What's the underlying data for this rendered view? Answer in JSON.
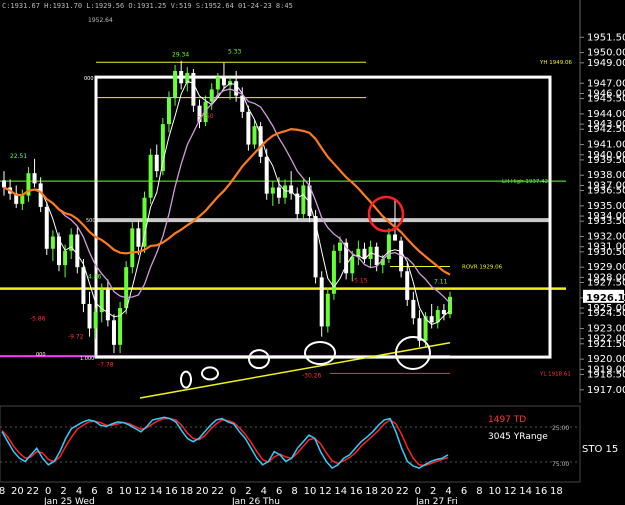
{
  "header": {
    "ohlc_text": "C:1931.67 H:1931.70 L:1929.56 O:1931.25 V:519 S:1952.64 01-24-23 8:45",
    "top_price": "1952.64"
  },
  "colors": {
    "background": "#000000",
    "candle_up": "#66ff33",
    "candle_down": "#ffffff",
    "white_box": "#ffffff",
    "gray_line": "#c8c8c8",
    "orange_ma": "#ff7a1a",
    "pink_ma": "#d49adf",
    "white_ma": "#ffffff",
    "yellow": "#f2f21a",
    "green_level": "#66ff33",
    "magenta_level": "#ff33ff",
    "red_text": "#ff3333",
    "circle_red": "#ff2222",
    "sto_k": "#33ccff",
    "sto_d": "#ff2222"
  },
  "chart_data": {
    "type": "candlestick",
    "ylim": [
      1916,
      1952.8
    ],
    "y_axis_ticks": [
      "1951.50",
      "1950.00",
      "1949.00",
      "1947.00",
      "1946.00",
      "1945.50",
      "1944.00",
      "1943.00",
      "1942.50",
      "1941.00",
      "1940.00",
      "1939.50",
      "1938.00",
      "1937.00",
      "1936.50",
      "1935.00",
      "1934.00",
      "1933.50",
      "1932.00",
      "1931.00",
      "1930.50",
      "1929.00",
      "1928.00",
      "1927.50",
      "1926.00",
      "1925.00",
      "1924.50",
      "1923.00",
      "1922.00",
      "1921.50",
      "1920.00",
      "1919.00",
      "1918.50",
      "1917.00"
    ],
    "last_price": "1926.10",
    "x_hour_labels": [
      "8",
      "20",
      "22",
      "0",
      "2",
      "4",
      "6",
      "8",
      "10",
      "12",
      "14",
      "16",
      "18",
      "20",
      "22",
      "0",
      "2",
      "4",
      "6",
      "8",
      "10",
      "12",
      "14",
      "16",
      "18",
      "20",
      "22",
      "0",
      "2",
      "4",
      "6",
      "8",
      "10",
      "12",
      "14",
      "16",
      "18"
    ],
    "x_day_labels": [
      "Jan 25 Wed",
      "Jan 26 Thu",
      "Jan 27 Fri"
    ],
    "levels": [
      {
        "label": "YH 1949.06",
        "value": 1949.06,
        "color": "yellow"
      },
      {
        "label": "LH High 1937.42",
        "value": 1937.42,
        "color": "green"
      },
      {
        "label": "ROVR 1929.06",
        "value": 1929.06,
        "color": "yellow"
      },
      {
        "label": "",
        "value": 1926.9,
        "color": "yellow"
      },
      {
        "label": "",
        "value": 1933.6,
        "color": "gray"
      },
      {
        "label": "YL 1918.61",
        "value": 1918.61,
        "color": "red"
      },
      {
        "label": "",
        "value": 1920.3,
        "color": "magenta"
      }
    ],
    "annotations": [
      {
        "text": "29.34",
        "price": 1949.6,
        "color": "green"
      },
      {
        "text": "5.33",
        "price": 1949.9,
        "color": "green"
      },
      {
        "text": "22.51",
        "price": 1939.7,
        "color": "green"
      },
      {
        "text": "4.86",
        "price": 1927.9,
        "color": "green"
      },
      {
        "text": "7.11",
        "price": 1927.4,
        "color": "green"
      },
      {
        "text": "-5.86",
        "price": 1923.8,
        "color": "red"
      },
      {
        "text": "-9.72",
        "price": 1922.0,
        "color": "red"
      },
      {
        "text": "-7.78",
        "price": 1919.3,
        "color": "red"
      },
      {
        "text": "-5.15",
        "price": 1927.5,
        "color": "red"
      },
      {
        "text": "-30.26",
        "price": 1918.2,
        "color": "red"
      },
      {
        "text": "-2.50",
        "price": 1943.6,
        "color": "red"
      }
    ],
    "box_labels": [
      "000",
      "500",
      "1.000",
      "000"
    ],
    "candles": [
      {
        "o": 1937.5,
        "h": 1938.4,
        "l": 1936.0,
        "c": 1936.8
      },
      {
        "o": 1936.8,
        "h": 1937.6,
        "l": 1935.6,
        "c": 1936.2
      },
      {
        "o": 1936.2,
        "h": 1937.0,
        "l": 1934.8,
        "c": 1935.2
      },
      {
        "o": 1935.2,
        "h": 1936.6,
        "l": 1934.6,
        "c": 1936.0
      },
      {
        "o": 1936.0,
        "h": 1938.8,
        "l": 1935.4,
        "c": 1938.2
      },
      {
        "o": 1938.2,
        "h": 1939.6,
        "l": 1936.8,
        "c": 1937.2
      },
      {
        "o": 1937.2,
        "h": 1937.8,
        "l": 1934.4,
        "c": 1934.9
      },
      {
        "o": 1934.9,
        "h": 1935.4,
        "l": 1930.2,
        "c": 1930.8
      },
      {
        "o": 1930.8,
        "h": 1932.6,
        "l": 1929.6,
        "c": 1932.0
      },
      {
        "o": 1932.0,
        "h": 1932.4,
        "l": 1928.6,
        "c": 1929.2
      },
      {
        "o": 1929.2,
        "h": 1931.2,
        "l": 1928.0,
        "c": 1930.6
      },
      {
        "o": 1930.6,
        "h": 1932.8,
        "l": 1929.8,
        "c": 1932.2
      },
      {
        "o": 1932.2,
        "h": 1932.9,
        "l": 1928.4,
        "c": 1929.0
      },
      {
        "o": 1929.0,
        "h": 1929.8,
        "l": 1924.6,
        "c": 1925.4
      },
      {
        "o": 1925.4,
        "h": 1926.6,
        "l": 1922.2,
        "c": 1923.0
      },
      {
        "o": 1923.0,
        "h": 1925.0,
        "l": 1922.0,
        "c": 1924.6
      },
      {
        "o": 1924.6,
        "h": 1927.4,
        "l": 1923.6,
        "c": 1926.8
      },
      {
        "o": 1926.8,
        "h": 1927.8,
        "l": 1923.2,
        "c": 1923.8
      },
      {
        "o": 1923.8,
        "h": 1924.4,
        "l": 1920.6,
        "c": 1921.4
      },
      {
        "o": 1921.4,
        "h": 1925.6,
        "l": 1920.6,
        "c": 1925.0
      },
      {
        "o": 1925.0,
        "h": 1929.6,
        "l": 1924.4,
        "c": 1929.0
      },
      {
        "o": 1929.0,
        "h": 1933.4,
        "l": 1928.4,
        "c": 1932.8
      },
      {
        "o": 1932.8,
        "h": 1933.6,
        "l": 1930.2,
        "c": 1931.0
      },
      {
        "o": 1931.0,
        "h": 1936.4,
        "l": 1930.4,
        "c": 1935.8
      },
      {
        "o": 1935.8,
        "h": 1940.6,
        "l": 1935.2,
        "c": 1940.0
      },
      {
        "o": 1940.0,
        "h": 1941.0,
        "l": 1937.8,
        "c": 1938.4
      },
      {
        "o": 1938.4,
        "h": 1943.6,
        "l": 1938.0,
        "c": 1943.0
      },
      {
        "o": 1943.0,
        "h": 1946.2,
        "l": 1942.2,
        "c": 1945.6
      },
      {
        "o": 1945.6,
        "h": 1948.8,
        "l": 1944.8,
        "c": 1948.2
      },
      {
        "o": 1948.2,
        "h": 1949.2,
        "l": 1946.4,
        "c": 1947.0
      },
      {
        "o": 1947.0,
        "h": 1948.6,
        "l": 1946.2,
        "c": 1948.0
      },
      {
        "o": 1948.0,
        "h": 1948.4,
        "l": 1944.2,
        "c": 1944.8
      },
      {
        "o": 1944.8,
        "h": 1945.4,
        "l": 1942.6,
        "c": 1943.2
      },
      {
        "o": 1943.2,
        "h": 1945.8,
        "l": 1942.8,
        "c": 1945.2
      },
      {
        "o": 1945.2,
        "h": 1947.0,
        "l": 1944.4,
        "c": 1946.4
      },
      {
        "o": 1946.4,
        "h": 1948.0,
        "l": 1945.6,
        "c": 1947.6
      },
      {
        "o": 1947.6,
        "h": 1949.0,
        "l": 1946.4,
        "c": 1946.8
      },
      {
        "o": 1946.8,
        "h": 1947.6,
        "l": 1945.4,
        "c": 1947.2
      },
      {
        "o": 1947.2,
        "h": 1948.2,
        "l": 1945.2,
        "c": 1945.8
      },
      {
        "o": 1945.8,
        "h": 1946.6,
        "l": 1943.6,
        "c": 1944.2
      },
      {
        "o": 1944.2,
        "h": 1944.8,
        "l": 1940.4,
        "c": 1941.0
      },
      {
        "o": 1941.0,
        "h": 1943.4,
        "l": 1940.6,
        "c": 1942.8
      },
      {
        "o": 1942.8,
        "h": 1943.2,
        "l": 1939.2,
        "c": 1939.8
      },
      {
        "o": 1939.8,
        "h": 1940.6,
        "l": 1935.6,
        "c": 1936.2
      },
      {
        "o": 1936.2,
        "h": 1937.4,
        "l": 1935.0,
        "c": 1936.8
      },
      {
        "o": 1936.8,
        "h": 1937.8,
        "l": 1935.2,
        "c": 1935.8
      },
      {
        "o": 1935.8,
        "h": 1937.6,
        "l": 1935.2,
        "c": 1937.0
      },
      {
        "o": 1937.0,
        "h": 1938.4,
        "l": 1935.6,
        "c": 1936.2
      },
      {
        "o": 1936.2,
        "h": 1936.8,
        "l": 1933.6,
        "c": 1934.2
      },
      {
        "o": 1934.2,
        "h": 1937.6,
        "l": 1933.8,
        "c": 1937.0
      },
      {
        "o": 1937.0,
        "h": 1937.8,
        "l": 1933.4,
        "c": 1934.0
      },
      {
        "o": 1934.0,
        "h": 1934.6,
        "l": 1927.4,
        "c": 1928.0
      },
      {
        "o": 1928.0,
        "h": 1928.6,
        "l": 1922.2,
        "c": 1923.2
      },
      {
        "o": 1923.2,
        "h": 1927.0,
        "l": 1922.6,
        "c": 1926.4
      },
      {
        "o": 1926.4,
        "h": 1931.2,
        "l": 1925.8,
        "c": 1930.6
      },
      {
        "o": 1930.6,
        "h": 1932.0,
        "l": 1929.4,
        "c": 1931.4
      },
      {
        "o": 1931.4,
        "h": 1931.8,
        "l": 1927.8,
        "c": 1928.4
      },
      {
        "o": 1928.4,
        "h": 1930.6,
        "l": 1927.6,
        "c": 1930.0
      },
      {
        "o": 1930.0,
        "h": 1931.6,
        "l": 1929.2,
        "c": 1930.8
      },
      {
        "o": 1930.8,
        "h": 1931.4,
        "l": 1929.4,
        "c": 1929.8
      },
      {
        "o": 1929.8,
        "h": 1931.6,
        "l": 1929.0,
        "c": 1931.0
      },
      {
        "o": 1931.0,
        "h": 1931.4,
        "l": 1928.6,
        "c": 1929.2
      },
      {
        "o": 1929.2,
        "h": 1930.2,
        "l": 1928.4,
        "c": 1929.8
      },
      {
        "o": 1929.8,
        "h": 1932.8,
        "l": 1929.4,
        "c": 1932.2
      },
      {
        "o": 1932.2,
        "h": 1935.6,
        "l": 1931.8,
        "c": 1931.6
      },
      {
        "o": 1931.6,
        "h": 1932.0,
        "l": 1928.0,
        "c": 1928.6
      },
      {
        "o": 1928.6,
        "h": 1929.4,
        "l": 1925.2,
        "c": 1925.8
      },
      {
        "o": 1925.8,
        "h": 1926.6,
        "l": 1923.4,
        "c": 1924.0
      },
      {
        "o": 1924.0,
        "h": 1924.8,
        "l": 1921.2,
        "c": 1921.8
      },
      {
        "o": 1921.8,
        "h": 1924.6,
        "l": 1921.2,
        "c": 1924.2
      },
      {
        "o": 1924.2,
        "h": 1925.4,
        "l": 1923.0,
        "c": 1923.6
      },
      {
        "o": 1923.6,
        "h": 1925.2,
        "l": 1923.0,
        "c": 1924.8
      },
      {
        "o": 1924.8,
        "h": 1925.4,
        "l": 1923.8,
        "c": 1924.4
      },
      {
        "o": 1924.4,
        "h": 1926.6,
        "l": 1924.0,
        "c": 1926.1
      }
    ],
    "sto_labels": {
      "td": "1497 TD",
      "yrange": "3045 YRange",
      "sto": "STO 15",
      "lvl25": "25.00",
      "lvl75": "75.00"
    },
    "sto_k": [
      70,
      55,
      40,
      30,
      25,
      35,
      45,
      30,
      20,
      25,
      40,
      60,
      75,
      80,
      85,
      88,
      86,
      80,
      78,
      82,
      85,
      84,
      80,
      75,
      70,
      78,
      88,
      90,
      92,
      90,
      85,
      72,
      60,
      55,
      60,
      70,
      80,
      88,
      90,
      85,
      82,
      70,
      60,
      45,
      30,
      20,
      25,
      40,
      35,
      25,
      30,
      45,
      55,
      65,
      60,
      40,
      25,
      15,
      20,
      30,
      35,
      45,
      55,
      62,
      70,
      80,
      88,
      90,
      70,
      45,
      25,
      18,
      15,
      20,
      25,
      28,
      30,
      35
    ],
    "sto_d": [
      72,
      62,
      48,
      38,
      30,
      32,
      40,
      38,
      28,
      25,
      32,
      48,
      62,
      74,
      80,
      85,
      86,
      84,
      80,
      80,
      82,
      84,
      82,
      78,
      74,
      76,
      82,
      87,
      90,
      90,
      88,
      80,
      68,
      60,
      58,
      64,
      74,
      82,
      88,
      87,
      84,
      76,
      66,
      54,
      40,
      28,
      24,
      32,
      36,
      32,
      30,
      38,
      48,
      58,
      60,
      52,
      38,
      26,
      22,
      26,
      31,
      38,
      48,
      56,
      64,
      72,
      82,
      88,
      82,
      66,
      46,
      30,
      20,
      19,
      22,
      25,
      28,
      31
    ]
  }
}
